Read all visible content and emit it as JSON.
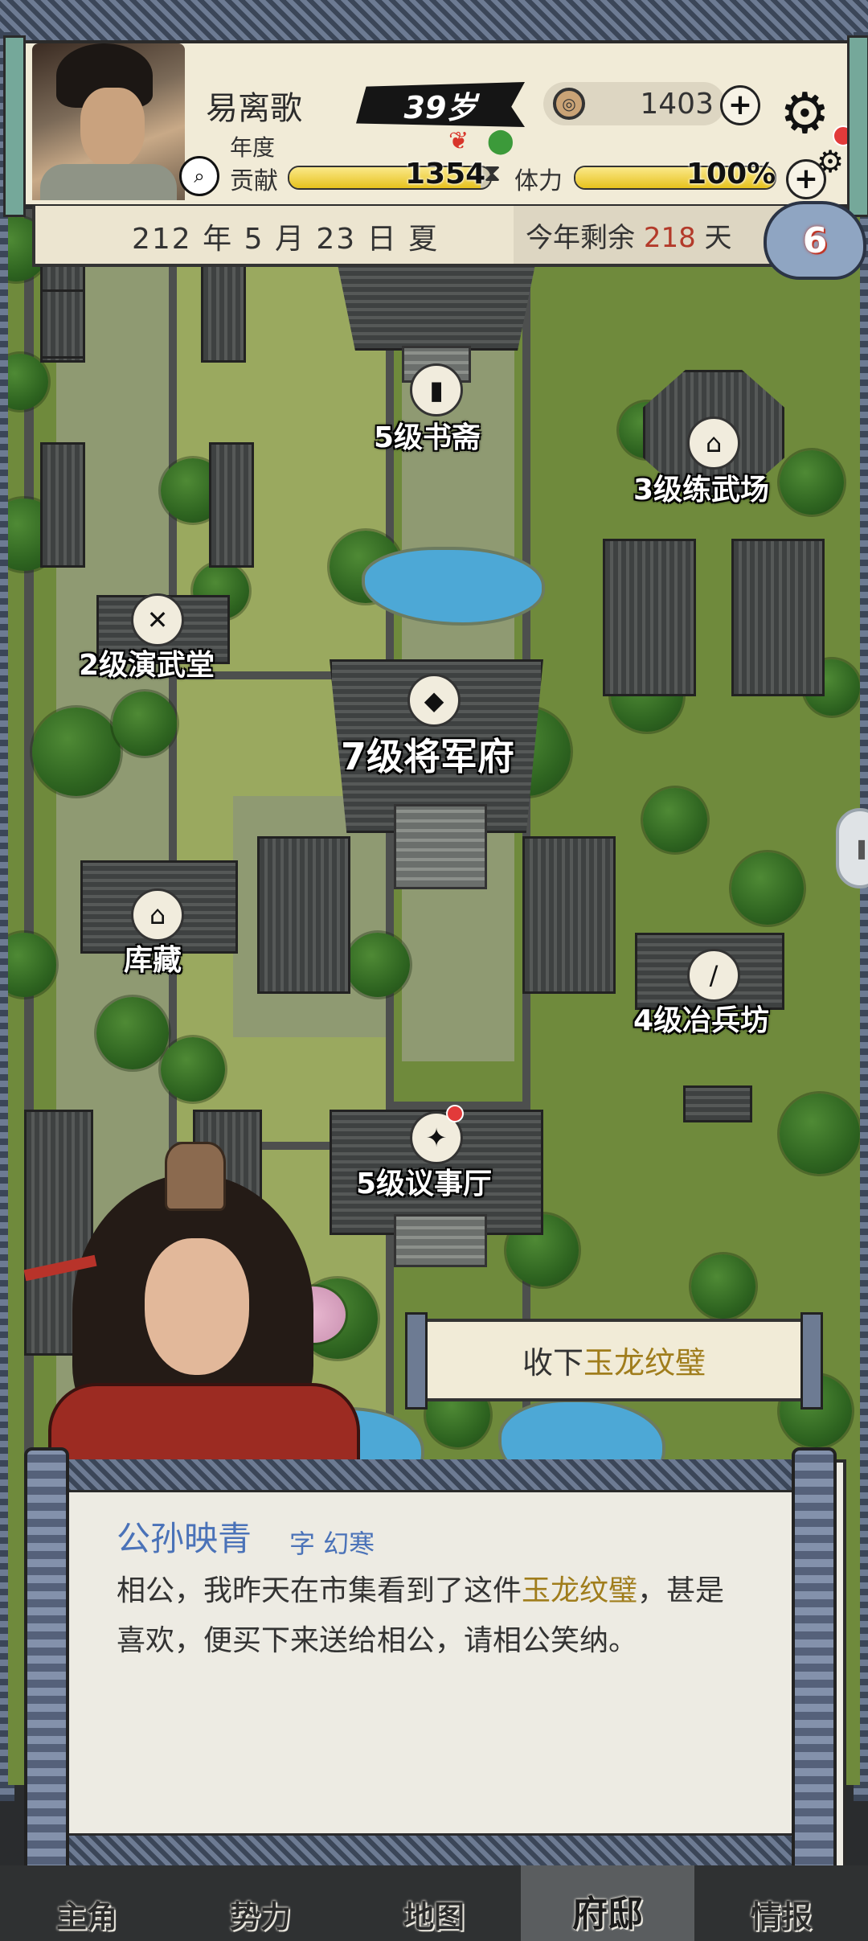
{
  "player": {
    "name": "易离歌",
    "age": "39岁",
    "coins": "1403",
    "year_label": "年度",
    "contribution_label": "贡献",
    "contribution_value": "1354",
    "contribution_fraction": 0.95,
    "stamina_label": "体力",
    "stamina_value": "100%",
    "stamina_fraction": 1.0
  },
  "date": {
    "text": "212 年 5 月 23 日 夏",
    "remaining_prefix": "今年剩余",
    "remaining_days": "218",
    "remaining_suffix": "天",
    "event_count": "6"
  },
  "buildings": [
    {
      "label": "5级书斋",
      "icon": "book-icon"
    },
    {
      "label": "3级练武场",
      "icon": "helmet-icon"
    },
    {
      "label": "2级演武堂",
      "icon": "crossed-swords-icon"
    },
    {
      "label": "7级将军府",
      "icon": "armor-icon"
    },
    {
      "label": "库藏",
      "icon": "house-icon"
    },
    {
      "label": "4级冶兵坊",
      "icon": "blade-icon"
    },
    {
      "label": "5级议事厅",
      "icon": "figure-icon"
    }
  ],
  "action": {
    "prefix": "收下",
    "item": "玉龙纹璧"
  },
  "dialogue": {
    "speaker": "公孙映青",
    "courtesy": "字 幻寒",
    "line_part1": "相公，我昨天在市集看到了这件",
    "line_item": "玉龙纹璧",
    "line_part2": "，甚是喜欢，便买下来送给相公，请相公笑纳。"
  },
  "nav": [
    "主角",
    "势力",
    "地图",
    "府邸",
    "情报"
  ],
  "colors": {
    "accent_gold": "#a07d1c",
    "speaker_blue": "#4a72b8",
    "days_red": "#b33a2a"
  }
}
